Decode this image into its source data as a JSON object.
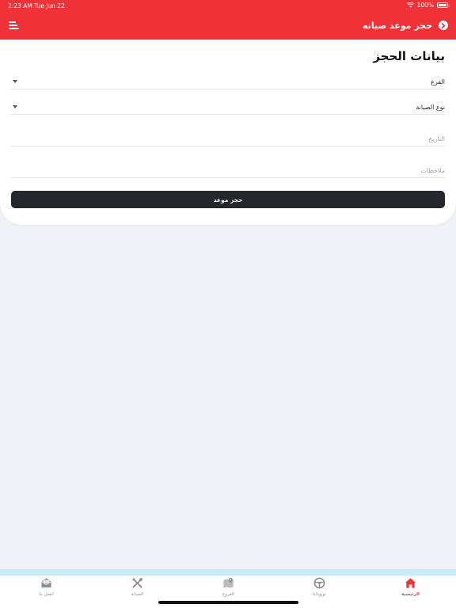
{
  "status_bar": {
    "time": "2:23 AM",
    "date": "Tue Jun 22",
    "battery": "100%"
  },
  "header": {
    "title": "حجز موعد صيانه",
    "back_icon": "chevron-circle-icon",
    "menu_icon": "menu-icon",
    "color": "#ef3237"
  },
  "form": {
    "title": "بيانات الحجز",
    "branch": {
      "value": "الفرع"
    },
    "service_type": {
      "value": "نوع الصيانة"
    },
    "date": {
      "placeholder": "التاريخ"
    },
    "notes": {
      "placeholder": "ملاحظات"
    },
    "submit_label": "حجز موعد"
  },
  "tabbar": {
    "items": [
      {
        "label": "الرئيسية",
        "icon": "home-icon",
        "active": true
      },
      {
        "label": "تويوتاتنا",
        "icon": "steering-wheel-icon",
        "active": false
      },
      {
        "label": "الفروع",
        "icon": "map-pin-icon",
        "active": false
      },
      {
        "label": "الصيانة",
        "icon": "tools-icon",
        "active": false
      },
      {
        "label": "اتصل بنا",
        "icon": "mail-icon",
        "active": false
      }
    ]
  }
}
